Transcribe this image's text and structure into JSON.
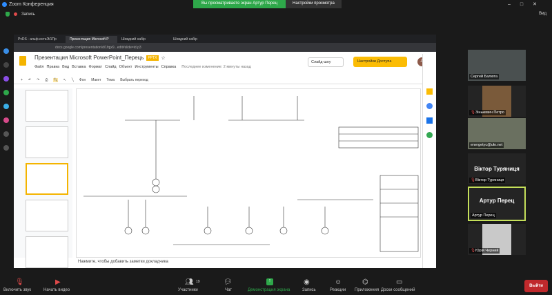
{
  "titlebar": {
    "title": "Zoom Конференция",
    "banner_text": "Вы просматриваете экран Артур Перец",
    "view_settings": "Настройки просмотра",
    "record": "Запись",
    "view": "Вид"
  },
  "browser": {
    "tabs": [
      "PvDS - альф.ентаЭ/1Пр",
      "Презентация Microsoft P",
      "Шовдний набір",
      "Шовдний набір"
    ],
    "url": "docs.google.com/presentation/d/1fqjx9...edit#slide=id.p3"
  },
  "doc": {
    "title": "Презентация Microsoft PowerPoint_Перець",
    "badge": "PPTX",
    "menu": [
      "Файл",
      "Правка",
      "Вид",
      "Вставка",
      "Формат",
      "Слайд",
      "Объект",
      "Инструменты",
      "Справка"
    ],
    "last_edit": "Последнее изменение: 2 минуты назад",
    "slideshow": "Слайд-шоу",
    "access": "Настройки Доступа",
    "avatar": "А"
  },
  "toolbar": [
    "Фон",
    "Макет",
    "Тема",
    "Выбрать переход"
  ],
  "notes": "Нажмите, чтобы добавить заметки докладчика",
  "participants": [
    {
      "name": "Сергей Балюта",
      "video": true,
      "muted": false
    },
    {
      "name": "Зіньке­вич Петро",
      "video": true,
      "muted": true
    },
    {
      "name": "energetyc@ukr.net",
      "video": true,
      "muted": false
    },
    {
      "name": "Віктор Туряниця",
      "big": "Віктор Туряниця",
      "video": false,
      "muted": true
    },
    {
      "name": "Артур Перец",
      "big": "Артур Перец",
      "video": false,
      "muted": false,
      "active": true
    },
    {
      "name": "Юрій Черний",
      "video": true,
      "muted": true
    }
  ],
  "bottom": {
    "mute": "Включить звук",
    "video": "Начать видео",
    "participants": "Участники",
    "participant_count": "19",
    "chat": "Чат",
    "share": "Демонстрация экрана",
    "record": "Запись",
    "reactions": "Реакции",
    "apps": "Приложения",
    "boards": "Доски сообщений",
    "leave": "Выйти"
  },
  "colors": {
    "share_green": "#2ea84a",
    "leave_red": "#c0292c",
    "active_border": "#c5e05a",
    "access_yellow": "#fbbc04"
  }
}
